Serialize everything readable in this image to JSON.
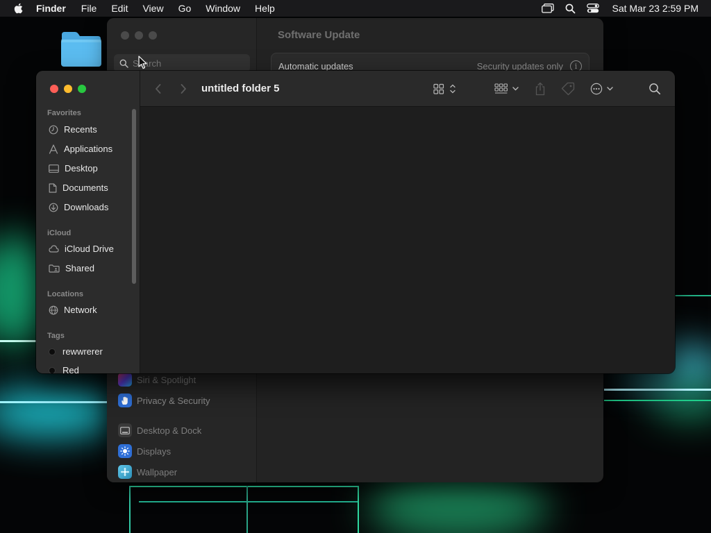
{
  "menubar": {
    "apple_icon": "apple-logo-icon",
    "app_name": "Finder",
    "menus": [
      "File",
      "Edit",
      "View",
      "Go",
      "Window",
      "Help"
    ],
    "status_icons": [
      "screen-mirroring-icon",
      "spotlight-search-icon",
      "control-center-icon"
    ],
    "clock": "Sat Mar 23  2:59 PM"
  },
  "desktop": {
    "folder_icon": "folder-icon"
  },
  "settings_window": {
    "title": "Software Update",
    "search_placeholder": "Search",
    "automatic_updates_label": "Automatic updates",
    "automatic_updates_value": "Security updates only",
    "info_glyph": "i",
    "sidebar_items": [
      {
        "label": "Siri & Spotlight",
        "icon": "siri-icon",
        "color": "#7a3cc6"
      },
      {
        "label": "Privacy & Security",
        "icon": "hand-icon",
        "color": "#2f6fd6"
      },
      {
        "label": "Desktop & Dock",
        "icon": "dock-icon",
        "color": "#3a3a3a"
      },
      {
        "label": "Displays",
        "icon": "sun-icon",
        "color": "#2f6fd6"
      },
      {
        "label": "Wallpaper",
        "icon": "wallpaper-icon",
        "color": "#3fa0c8"
      }
    ]
  },
  "finder": {
    "folder_title": "untitled folder 5",
    "traffic_lights": {
      "close": "#ff5f57",
      "minimize": "#febc2e",
      "zoom": "#28c840"
    },
    "toolbar_icons": [
      "back-icon",
      "forward-icon",
      "icon-view-icon",
      "group-icon",
      "share-icon",
      "tag-icon",
      "more-actions-icon",
      "search-icon"
    ],
    "sidebar": {
      "favorites_heading": "Favorites",
      "favorites": [
        {
          "label": "Recents",
          "icon": "clock-icon"
        },
        {
          "label": "Applications",
          "icon": "applications-icon"
        },
        {
          "label": "Desktop",
          "icon": "desktop-icon"
        },
        {
          "label": "Documents",
          "icon": "document-icon"
        },
        {
          "label": "Downloads",
          "icon": "download-icon"
        }
      ],
      "icloud_heading": "iCloud",
      "icloud": [
        {
          "label": "iCloud Drive",
          "icon": "cloud-icon"
        },
        {
          "label": "Shared",
          "icon": "shared-folder-icon"
        }
      ],
      "locations_heading": "Locations",
      "locations": [
        {
          "label": "Network",
          "icon": "globe-icon"
        }
      ],
      "tags_heading": "Tags",
      "tags": [
        {
          "label": "rewwrerer",
          "icon": "tag-dot-icon"
        },
        {
          "label": "Red",
          "icon": "tag-dot-icon"
        }
      ]
    }
  }
}
